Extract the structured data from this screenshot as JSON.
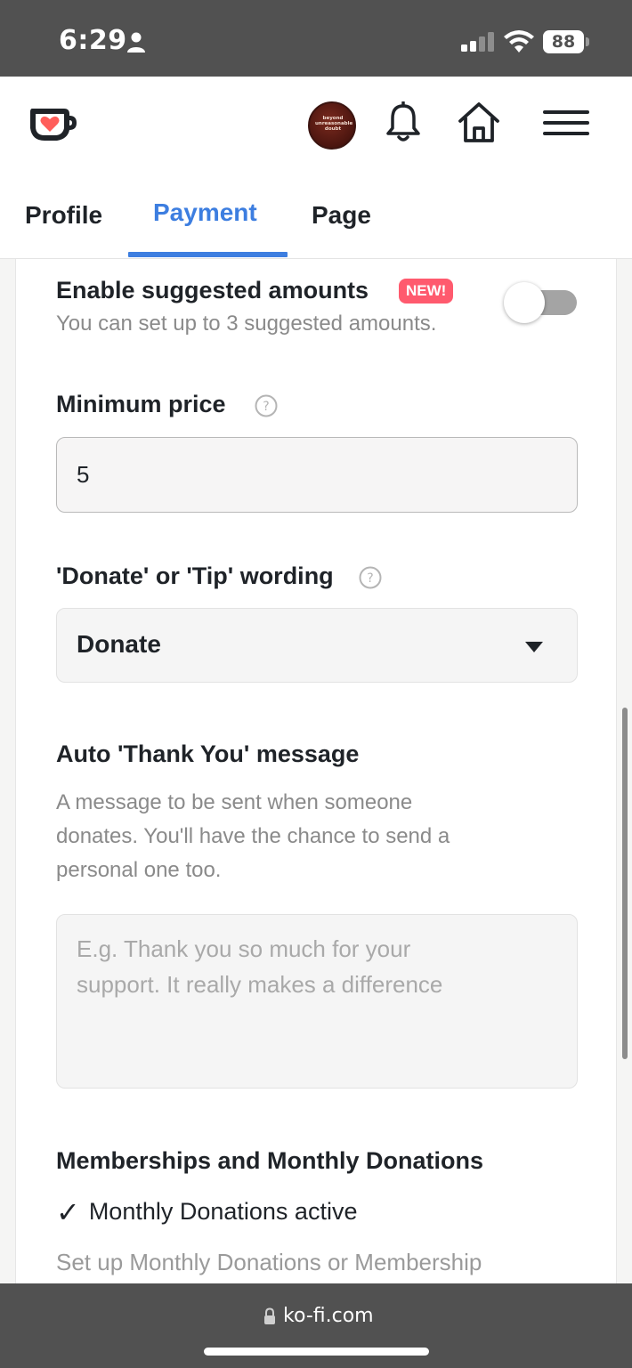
{
  "status_bar": {
    "time": "6:29",
    "battery": "88"
  },
  "header": {
    "avatar_text": "beyond unreasonable doubt"
  },
  "tabs": [
    {
      "label": "Profile"
    },
    {
      "label": "Payment"
    },
    {
      "label": "Page"
    }
  ],
  "suggested": {
    "label": "Enable suggested amounts",
    "badge": "NEW!",
    "description": "You can set up to 3 suggested amounts."
  },
  "minimum_price": {
    "label": "Minimum price",
    "value": "5"
  },
  "wording": {
    "label": "'Donate' or 'Tip' wording",
    "value": "Donate"
  },
  "thank_you": {
    "label": "Auto 'Thank You' message",
    "description_lines": [
      "A message to be sent when someone",
      "donates. You'll have the chance to send a",
      "personal one too."
    ],
    "placeholder_lines": [
      "E.g. Thank you so much for your",
      "support. It really makes a difference"
    ]
  },
  "memberships": {
    "label": "Memberships and Monthly Donations",
    "status": "Monthly Donations active",
    "setup_text": "Set up Monthly Donations or Membership"
  },
  "url_bar": {
    "domain": "ko-fi.com"
  },
  "colors": {
    "accent": "#3d7ee0",
    "badge": "#ff5a6e",
    "logo_heart": "#ff5e5b"
  }
}
